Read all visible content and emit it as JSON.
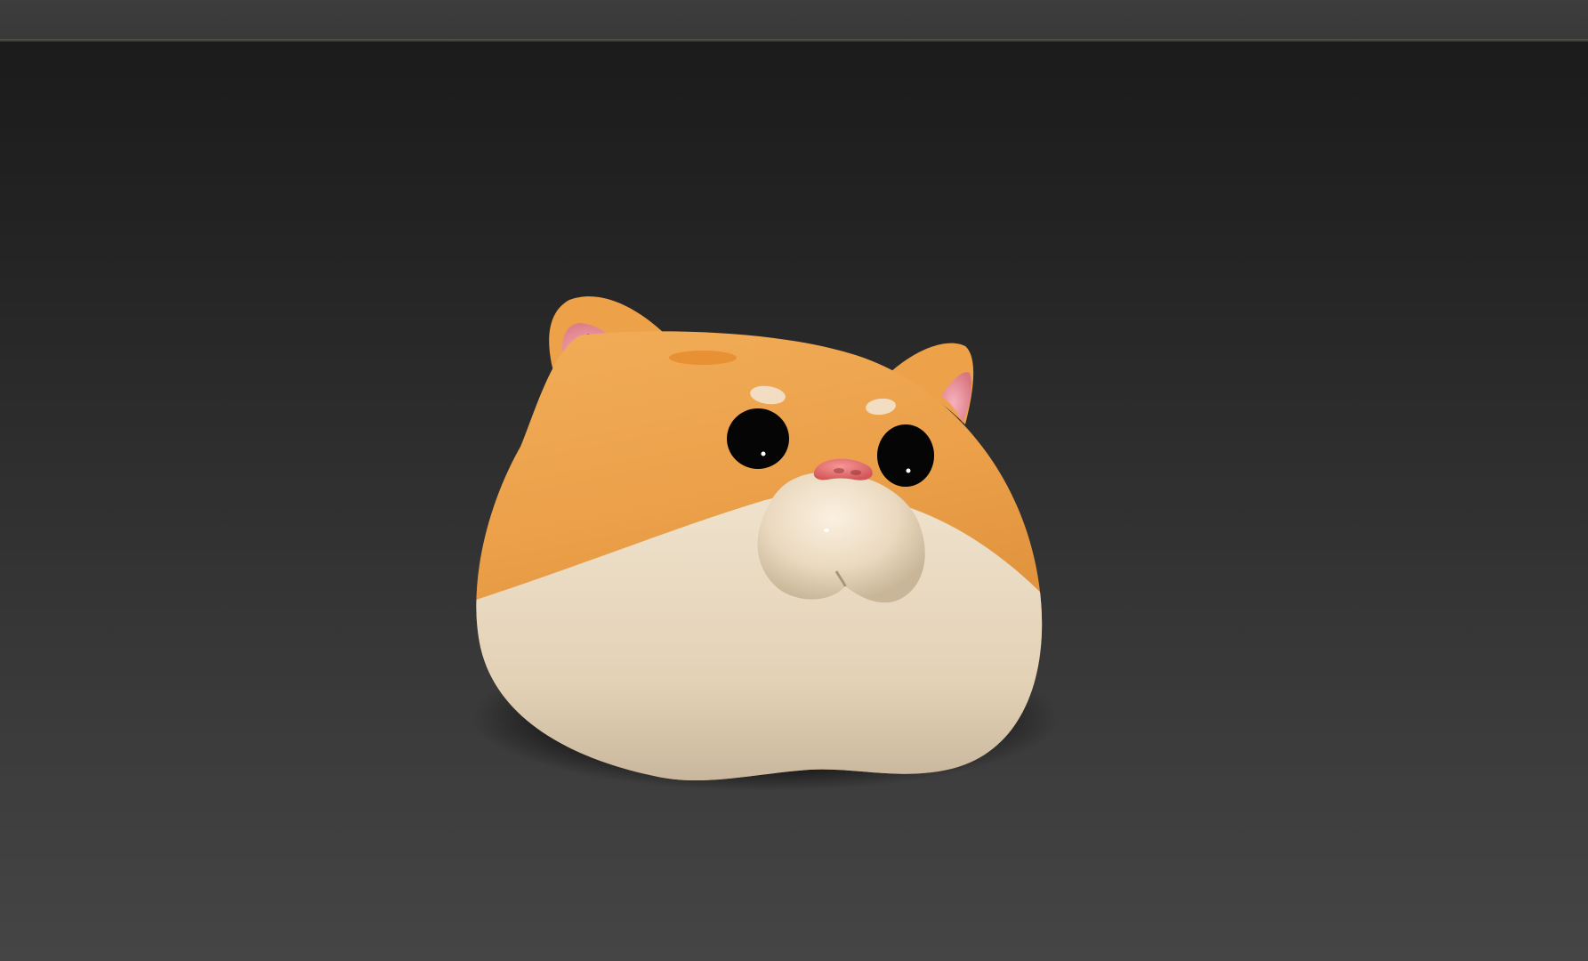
{
  "viewport": {
    "model_icon": "hamster-head-3d-model-icon",
    "colors": {
      "background_top": "#1b1b1b",
      "background_bottom": "#454545",
      "fur_orange": "#eda24a",
      "fur_cream": "#ecdcc4",
      "ear_inner_pink": "#ef96a4",
      "nose_pink": "#e9706f",
      "eye_black": "#050505"
    }
  }
}
